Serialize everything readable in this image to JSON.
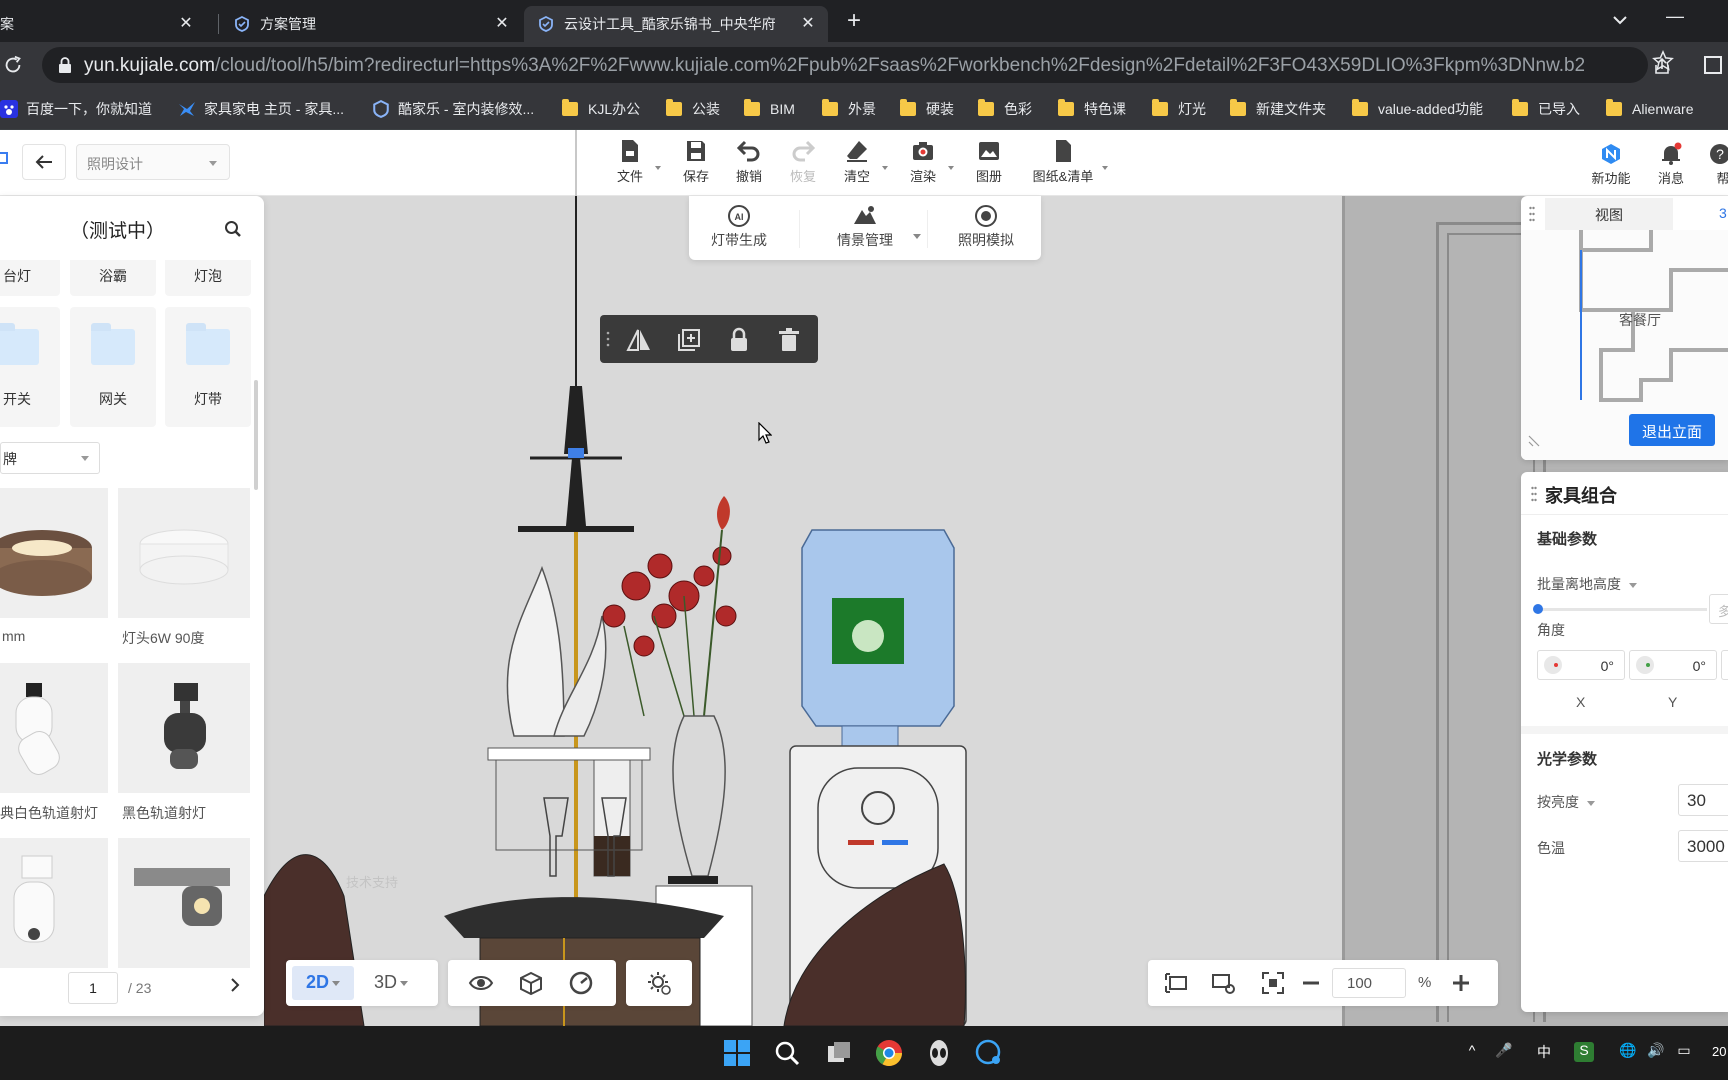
{
  "browser": {
    "tabs": [
      {
        "title": "案",
        "active": false
      },
      {
        "title": "方案管理",
        "active": false
      },
      {
        "title": "云设计工具_酷家乐锦书_中央华府",
        "active": true
      }
    ],
    "url_domain": "yun.kujiale.com",
    "url_path": "/cloud/tool/h5/bim?redirecturl=https%3A%2F%2Fwww.kujiale.com%2Fpub%2Fsaas%2Fworkbench%2Fdesign%2Fdetail%2F3FO43X59DLIO%3Fkpm%3DNnw.b2...",
    "bookmarks": [
      {
        "label": "百度一下，你就知道",
        "icon": "baidu-icon"
      },
      {
        "label": "家具家电 主页 - 家具...",
        "icon": "kujiale-bird-icon"
      },
      {
        "label": "酷家乐 - 室内装修效...",
        "icon": "kujiale-shield-icon"
      },
      {
        "label": "KJL办公",
        "icon": "folder-icon"
      },
      {
        "label": "公装",
        "icon": "folder-icon"
      },
      {
        "label": "BIM",
        "icon": "folder-icon"
      },
      {
        "label": "外景",
        "icon": "folder-icon"
      },
      {
        "label": "硬装",
        "icon": "folder-icon"
      },
      {
        "label": "色彩",
        "icon": "folder-icon"
      },
      {
        "label": "特色课",
        "icon": "folder-icon"
      },
      {
        "label": "灯光",
        "icon": "folder-icon"
      },
      {
        "label": "新建文件夹",
        "icon": "folder-icon"
      },
      {
        "label": "value-added功能",
        "icon": "folder-icon"
      },
      {
        "label": "已导入",
        "icon": "folder-icon"
      },
      {
        "label": "Alienware",
        "icon": "folder-icon"
      }
    ]
  },
  "app": {
    "mode_select": "照明设计",
    "toolbar": [
      {
        "label": "文件",
        "icon": "file-icon",
        "dropdown": true
      },
      {
        "label": "保存",
        "icon": "save-icon",
        "dropdown": false
      },
      {
        "label": "撤销",
        "icon": "undo-icon",
        "dropdown": false
      },
      {
        "label": "恢复",
        "icon": "redo-icon",
        "dropdown": false,
        "disabled": true
      },
      {
        "label": "清空",
        "icon": "eraser-icon",
        "dropdown": true
      },
      {
        "label": "渲染",
        "icon": "camera-icon",
        "dropdown": true
      },
      {
        "label": "图册",
        "icon": "album-icon",
        "dropdown": false
      },
      {
        "label": "图纸&清单",
        "icon": "drawing-list-icon",
        "dropdown": true
      }
    ],
    "toolbar_right": [
      {
        "label": "新功能",
        "icon": "new-feature-icon"
      },
      {
        "label": "消息",
        "icon": "bell-icon"
      },
      {
        "label": "帮",
        "icon": "help-icon"
      }
    ],
    "lighting_tools": [
      {
        "label": "灯带生成",
        "icon": "ai-lightstrip-icon"
      },
      {
        "label": "情景管理",
        "icon": "scene-manage-icon",
        "dropdown": true
      },
      {
        "label": "照明模拟",
        "icon": "light-simulation-icon"
      }
    ]
  },
  "left_panel": {
    "title": "（测试中）",
    "category_row1": [
      "台灯",
      "浴霸",
      "灯泡"
    ],
    "category_row2": [
      "开关",
      "网关",
      "灯带"
    ],
    "brand_filter": "牌",
    "products": [
      {
        "label": "mm"
      },
      {
        "label": "灯头6W 90度"
      },
      {
        "label": "典白色轨道射灯"
      },
      {
        "label": "黑色轨道射灯"
      },
      {
        "label": ""
      },
      {
        "label": ""
      }
    ],
    "page_current": "1",
    "page_total": "/ 23"
  },
  "view_panel": {
    "tab": "视图",
    "tab2": "3",
    "room_label": "客餐厅",
    "exit_button": "退出立面"
  },
  "prop_panel": {
    "title": "家具组合",
    "basic_section": "基础参数",
    "height_label": "批量离地高度",
    "height_placeholder": "多",
    "angle_label": "角度",
    "angle_x": "0°",
    "angle_y": "0°",
    "axis_x": "X",
    "axis_y": "Y",
    "optics_section": "光学参数",
    "brightness_label": "按亮度",
    "brightness_value": "30",
    "color_temp_label": "色温",
    "color_temp_value": "3000"
  },
  "canvas_controls": {
    "view_2d": "2D",
    "view_3d": "3D",
    "zoom_value": "100",
    "zoom_unit": "%",
    "watermark": "技术支持"
  },
  "taskbar": {
    "time": "20"
  },
  "colors": {
    "accent": "#1f74e8",
    "browser_bg": "#202124",
    "browser_toolbar": "#35363a"
  }
}
